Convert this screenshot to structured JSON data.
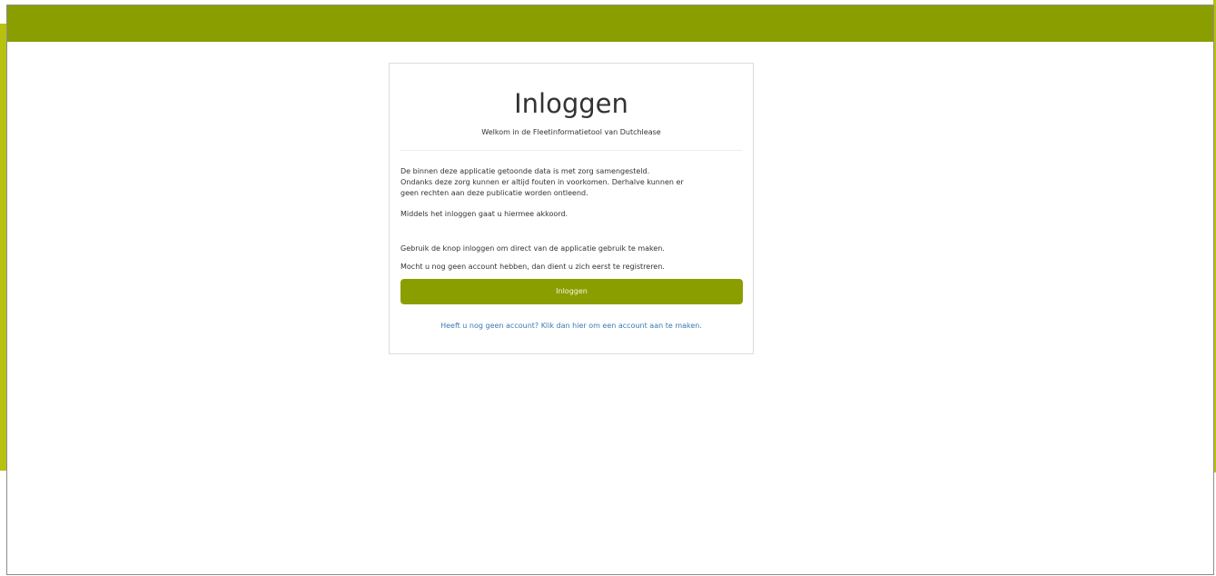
{
  "card": {
    "title": "Inloggen",
    "subtitle": "Welkom in de Fleetinformatietool van Dutchlease",
    "disclaimer": [
      "De binnen deze applicatie getoonde data is met zorg samengesteld.",
      "Ondanks deze zorg kunnen er altijd fouten in voorkomen. Derhalve kunnen er",
      "geen rechten aan deze publicatie worden ontleend."
    ],
    "agreement": "Middels het inloggen gaat u hiermee akkoord.",
    "instruction": "Gebruik de knop inloggen om direct van de applicatie gebruik te maken.",
    "register_hint": "Mocht u nog geen account hebben, dan dient u zich eerst te registreren.",
    "login_button": "Inloggen",
    "register_link": "Heeft u nog geen account? Klik dan hier om een account aan te maken."
  },
  "colors": {
    "brand": "#8b9e00",
    "accent_stripe": "#b7c10f",
    "link": "#3a78b5"
  }
}
